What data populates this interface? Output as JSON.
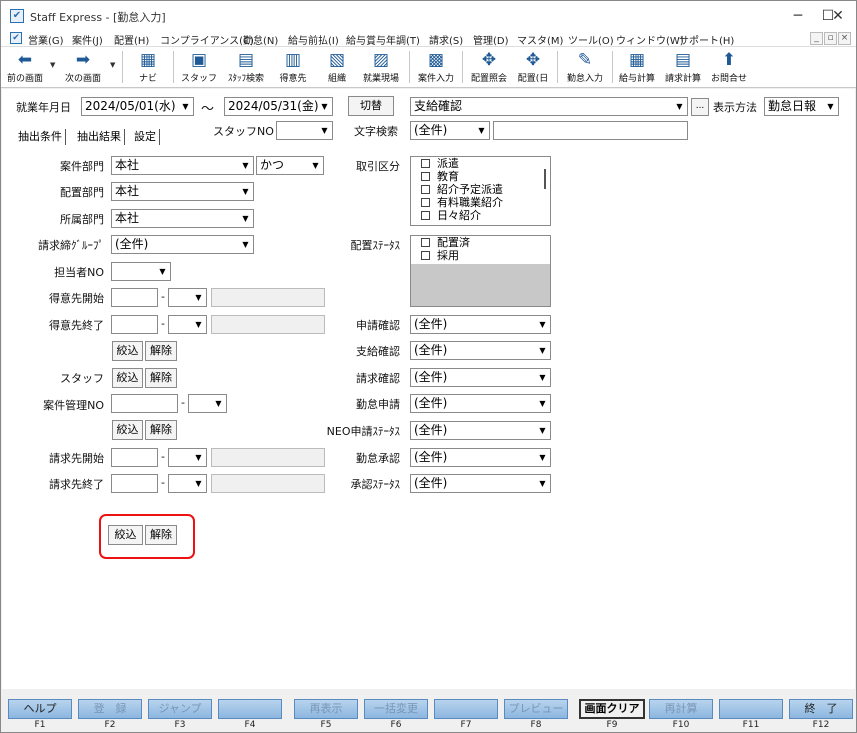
{
  "window": {
    "title": "Staff Express - [勤怠入力]",
    "minimize": "─",
    "maximize": "☐",
    "close": "✕"
  },
  "menubar": {
    "items": [
      "営業(G)",
      "案件(J)",
      "配置(H)",
      "コンプライアンス(C)",
      "勤怠(N)",
      "給与前払(I)",
      "給与賞与年調(T)",
      "請求(S)",
      "管理(D)",
      "マスタ(M)",
      "ツール(O)",
      "ウィンドウ(W)",
      "サポート(H)"
    ],
    "mdi": [
      "_",
      "▫",
      "×"
    ]
  },
  "toolbar": {
    "items": [
      {
        "label": "前の画面",
        "icon": "arrow-left-icon"
      },
      {
        "label": "次の画面",
        "icon": "arrow-right-icon"
      },
      {
        "label": "ナビ",
        "icon": "navi-icon"
      },
      {
        "label": "スタッフ",
        "icon": "staff-icon"
      },
      {
        "label": "ｽﾀｯﾌ検索",
        "icon": "staff-search-icon"
      },
      {
        "label": "得意先",
        "icon": "customer-icon"
      },
      {
        "label": "組織",
        "icon": "organization-icon"
      },
      {
        "label": "就業現場",
        "icon": "worksite-icon"
      },
      {
        "label": "案件入力",
        "icon": "project-input-icon"
      },
      {
        "label": "配置照会",
        "icon": "placement-inquiry-icon"
      },
      {
        "label": "配置(日",
        "icon": "placement-day-icon"
      },
      {
        "label": "勤怠入力",
        "icon": "attendance-input-icon"
      },
      {
        "label": "給与計算",
        "icon": "payroll-calc-icon"
      },
      {
        "label": "請求計算",
        "icon": "billing-calc-icon"
      },
      {
        "label": "お問合せ",
        "icon": "inquiry-icon"
      }
    ]
  },
  "header": {
    "period_label": "就業年月日",
    "from": "2024/05/01(水)",
    "tilde": "～",
    "to": "2024/05/31(金)",
    "toggle": "切替",
    "mode": "支給確認",
    "ellipsis": "...",
    "display_label": "表示方法",
    "display_value": "勤怠日報"
  },
  "tabs": {
    "items": [
      "抽出条件",
      "抽出結果",
      "設定"
    ],
    "staff_no_label": "スタッフNO",
    "text_search_label": "文字検索",
    "text_search_value": "(全件)"
  },
  "form": {
    "dept": {
      "label": "案件部門",
      "value": "本社",
      "cond": "かつ"
    },
    "placement_dept": {
      "label": "配置部門",
      "value": "本社"
    },
    "belong_dept": {
      "label": "所属部門",
      "value": "本社"
    },
    "billing_group": {
      "label": "請求締ｸﾞﾙｰﾌﾟ",
      "value": "(全件)"
    },
    "manager_no": {
      "label": "担当者NO"
    },
    "customer_start": {
      "label": "得意先開始"
    },
    "customer_end": {
      "label": "得意先終了"
    },
    "staff": {
      "label": "スタッフ"
    },
    "project_no": {
      "label": "案件管理NO"
    },
    "billto_start": {
      "label": "請求先開始"
    },
    "billto_end": {
      "label": "請求先終了"
    },
    "dash": "-",
    "narrow": "絞込",
    "clear": "解除"
  },
  "right": {
    "trade_label": "取引区分",
    "trade_items": [
      "派遣",
      "教育",
      "紹介予定派遣",
      "有料職業紹介",
      "日々紹介"
    ],
    "status_label": "配置ｽﾃｰﾀｽ",
    "status_items": [
      "配置済",
      "採用"
    ],
    "filters": [
      {
        "label": "申請確認",
        "value": "(全件)"
      },
      {
        "label": "支給確認",
        "value": "(全件)"
      },
      {
        "label": "請求確認",
        "value": "(全件)"
      },
      {
        "label": "勤怠申請",
        "value": "(全件)"
      },
      {
        "label": "NEO申請ｽﾃｰﾀｽ",
        "value": "(全件)"
      },
      {
        "label": "勤怠承認",
        "value": "(全件)"
      },
      {
        "label": "承認ｽﾃｰﾀｽ",
        "value": "(全件)"
      }
    ]
  },
  "fkeys": [
    {
      "label": "ヘルプ",
      "key": "F1"
    },
    {
      "label": "登　録",
      "key": "F2"
    },
    {
      "label": "ジャンプ",
      "key": "F3"
    },
    {
      "label": "",
      "key": "F4"
    },
    {
      "label": "再表示",
      "key": "F5"
    },
    {
      "label": "一括変更",
      "key": "F6"
    },
    {
      "label": "",
      "key": "F7"
    },
    {
      "label": "プレビュー",
      "key": "F8"
    },
    {
      "label": "画面クリア",
      "key": "F9"
    },
    {
      "label": "再計算",
      "key": "F10"
    },
    {
      "label": "",
      "key": "F11"
    },
    {
      "label": "終　了",
      "key": "F12"
    }
  ],
  "colors": {
    "fkey_bg": "#8cb6df",
    "highlight": "#e11111",
    "accent": "#1f5a96"
  }
}
